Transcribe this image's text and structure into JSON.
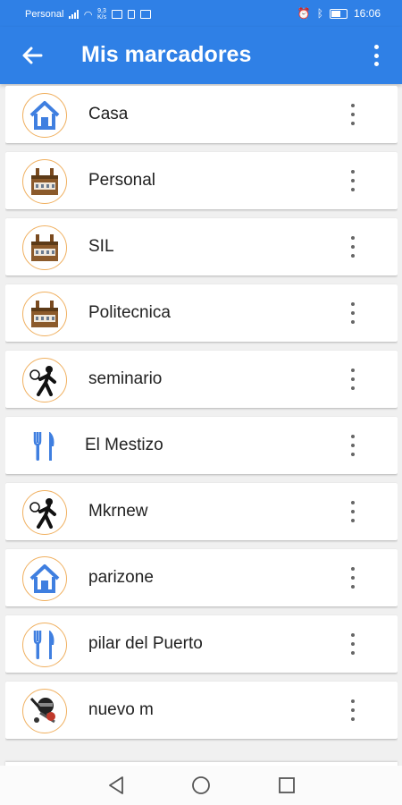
{
  "status_bar": {
    "carrier": "Personal",
    "speed": "9,3",
    "speed_unit": "K/s",
    "time": "16:06"
  },
  "app_bar": {
    "title": "Mis marcadores",
    "back_icon": "back-arrow-icon",
    "menu_icon": "more-vert-icon"
  },
  "bookmarks": [
    {
      "label": "Casa",
      "icon": "house-icon"
    },
    {
      "label": "Personal",
      "icon": "building-icon"
    },
    {
      "label": "SIL",
      "icon": "building-icon"
    },
    {
      "label": "Politecnica",
      "icon": "building-icon"
    },
    {
      "label": "seminario",
      "icon": "tennis-player-icon"
    },
    {
      "label": "El Mestizo",
      "icon": "fork-knife-icon"
    },
    {
      "label": "Mkrnew",
      "icon": "tennis-player-icon"
    },
    {
      "label": "parizone",
      "icon": "house-icon"
    },
    {
      "label": "pilar del Puerto",
      "icon": "fork-knife-icon"
    },
    {
      "label": "nuevo m",
      "icon": "hockey-player-icon"
    }
  ],
  "colors": {
    "primary": "#2f80e6",
    "icon_ring": "#f0b060",
    "house_blue": "#3f7fe0",
    "utensil_blue": "#3f7fe0",
    "building_brown": "#8b5a2b"
  },
  "nav_bar": {
    "back": "nav-back-icon",
    "home": "nav-home-icon",
    "recents": "nav-recents-icon"
  }
}
